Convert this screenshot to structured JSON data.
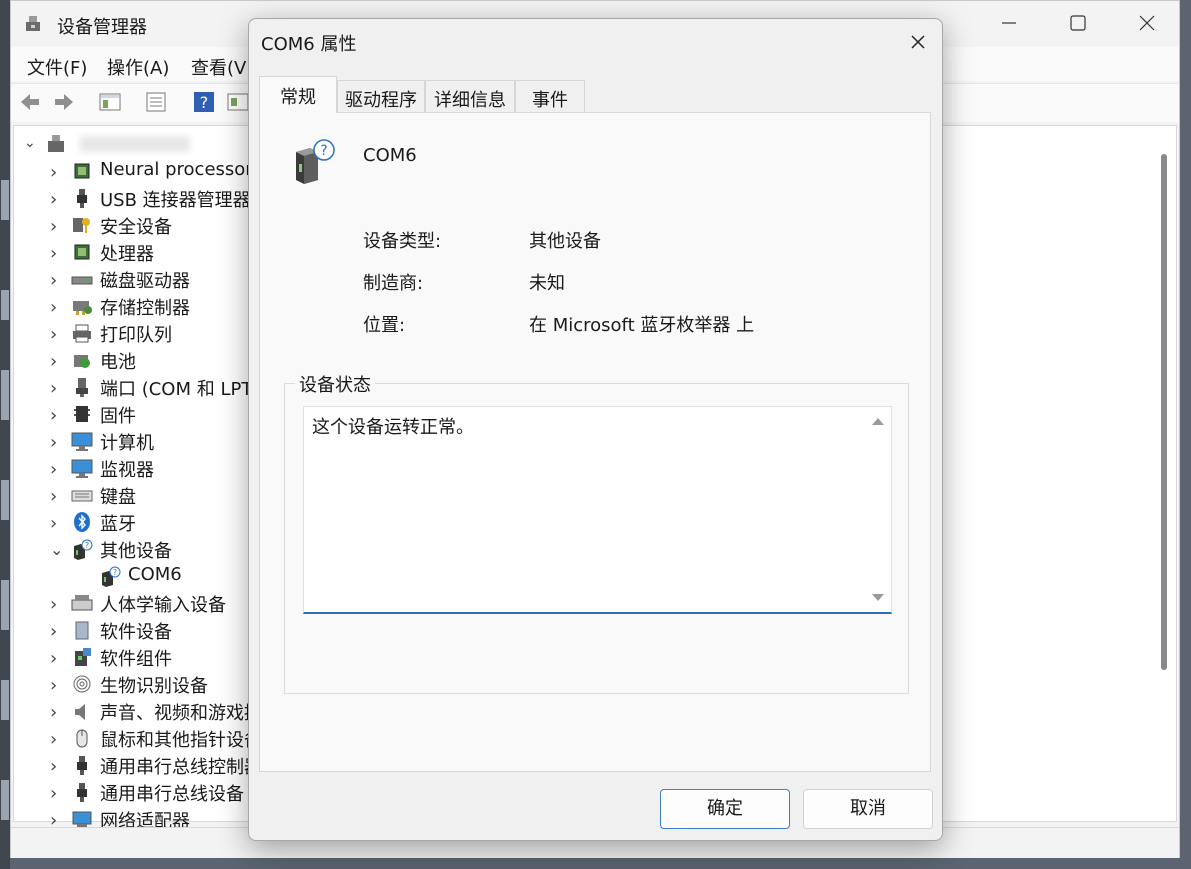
{
  "device_manager": {
    "title": "设备管理器",
    "menu": [
      "文件(F)",
      "操作(A)",
      "查看(V)"
    ],
    "tree": [
      {
        "label": "Neural processors",
        "icon": "chip-icon",
        "expanded": false
      },
      {
        "label": "USB 连接器管理器",
        "icon": "usb-plug-icon",
        "expanded": false
      },
      {
        "label": "安全设备",
        "icon": "key-icon",
        "expanded": false
      },
      {
        "label": "处理器",
        "icon": "chip-icon",
        "expanded": false
      },
      {
        "label": "磁盘驱动器",
        "icon": "disk-drive-icon",
        "expanded": false
      },
      {
        "label": "存储控制器",
        "icon": "storage-controller-icon",
        "expanded": false
      },
      {
        "label": "打印队列",
        "icon": "printer-icon",
        "expanded": false
      },
      {
        "label": "电池",
        "icon": "battery-icon",
        "expanded": false
      },
      {
        "label": "端口 (COM 和 LPT)",
        "icon": "port-icon",
        "expanded": false
      },
      {
        "label": "固件",
        "icon": "firmware-icon",
        "expanded": false
      },
      {
        "label": "计算机",
        "icon": "monitor-icon",
        "expanded": false
      },
      {
        "label": "监视器",
        "icon": "monitor-icon",
        "expanded": false
      },
      {
        "label": "键盘",
        "icon": "keyboard-icon",
        "expanded": false
      },
      {
        "label": "蓝牙",
        "icon": "bluetooth-icon",
        "expanded": false
      },
      {
        "label": "其他设备",
        "icon": "unknown-device-icon",
        "expanded": true
      },
      {
        "label": "COM6",
        "icon": "unknown-device-icon",
        "child": true
      },
      {
        "label": "人体学输入设备",
        "icon": "hid-icon",
        "expanded": false
      },
      {
        "label": "软件设备",
        "icon": "software-device-icon",
        "expanded": false
      },
      {
        "label": "软件组件",
        "icon": "software-component-icon",
        "expanded": false
      },
      {
        "label": "生物识别设备",
        "icon": "fingerprint-icon",
        "expanded": false
      },
      {
        "label": "声音、视频和游戏控制器",
        "icon": "speaker-icon",
        "expanded": false
      },
      {
        "label": "鼠标和其他指针设备",
        "icon": "mouse-icon",
        "expanded": false
      },
      {
        "label": "通用串行总线控制器",
        "icon": "usb-plug-icon",
        "expanded": false
      },
      {
        "label": "通用串行总线设备",
        "icon": "usb-plug-icon",
        "expanded": false
      },
      {
        "label": "网络适配器",
        "icon": "network-adapter-icon",
        "expanded": false
      }
    ]
  },
  "dialog": {
    "title": "COM6 属性",
    "tabs": [
      "常规",
      "驱动程序",
      "详细信息",
      "事件"
    ],
    "active_tab": 0,
    "device_name": "COM6",
    "properties": [
      {
        "label": "设备类型:",
        "value": "其他设备"
      },
      {
        "label": "制造商:",
        "value": "未知"
      },
      {
        "label": "位置:",
        "value": "在 Microsoft 蓝牙枚举器 上"
      }
    ],
    "status_group_label": "设备状态",
    "status_text": "这个设备运转正常。",
    "ok_label": "确定",
    "cancel_label": "取消"
  },
  "colors": {
    "accent": "#2d6fb6",
    "dialog_bg": "#f0f0f0",
    "panel_bg": "#f9f9f9"
  }
}
